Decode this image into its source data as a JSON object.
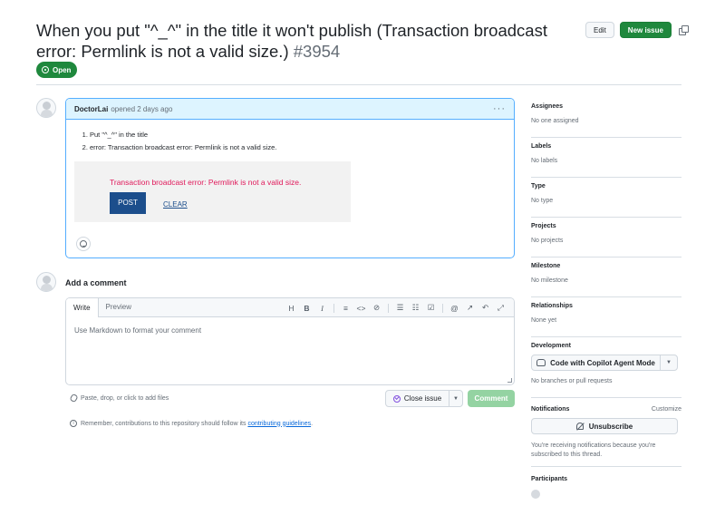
{
  "issue": {
    "title": "When you put \"^_^\" in the title it won't publish (Transaction broadcast error: Permlink is not a valid size.)",
    "number": "#3954",
    "state": "Open"
  },
  "header_actions": {
    "edit": "Edit",
    "new_issue": "New issue"
  },
  "comment": {
    "author": "DoctorLai",
    "meta": "opened 2 days ago",
    "list": [
      "Put \"^_^\" in the title",
      "error: Transaction broadcast error: Permlink is not a valid size."
    ],
    "embed": {
      "error": "Transaction broadcast error: Permlink is not a valid size.",
      "post": "POST",
      "clear": "CLEAR"
    }
  },
  "composer": {
    "heading": "Add a comment",
    "tabs": [
      "Write",
      "Preview"
    ],
    "placeholder": "Use Markdown to format your comment",
    "paste_hint": "Paste, drop, or click to add files",
    "close_issue": "Close issue",
    "comment_btn": "Comment",
    "remember_text": "Remember, contributions to this repository should follow its",
    "remember_link": "contributing guidelines",
    "tools": {
      "heading": "H",
      "bold": "B",
      "italic": "I"
    }
  },
  "sidebar": {
    "assignees": {
      "title": "Assignees",
      "value": "No one assigned"
    },
    "labels": {
      "title": "Labels",
      "value": "No labels"
    },
    "type": {
      "title": "Type",
      "value": "No type"
    },
    "projects": {
      "title": "Projects",
      "value": "No projects"
    },
    "milestone": {
      "title": "Milestone",
      "value": "No milestone"
    },
    "relationships": {
      "title": "Relationships",
      "value": "None yet"
    },
    "development": {
      "title": "Development",
      "button": "Code with Copilot Agent Mode",
      "value": "No branches or pull requests"
    },
    "notifications": {
      "title": "Notifications",
      "customize": "Customize",
      "button": "Unsubscribe",
      "note": "You're receiving notifications because you're subscribed to this thread."
    },
    "participants": {
      "title": "Participants"
    }
  }
}
